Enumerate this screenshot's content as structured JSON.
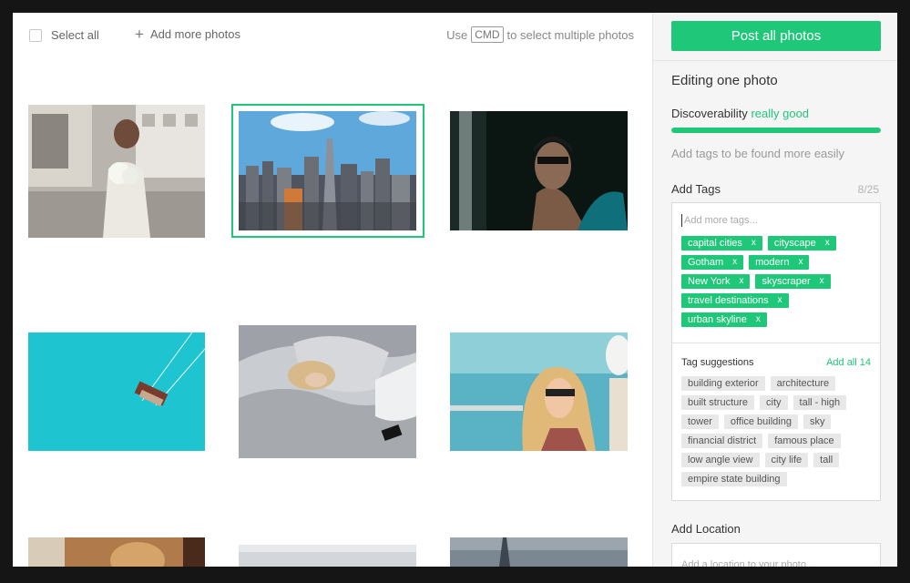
{
  "toolbar": {
    "select_all_label": "Select all",
    "add_more_label": "Add more photos",
    "hint_prefix": "Use",
    "hint_key": "CMD",
    "hint_suffix": "to select multiple photos"
  },
  "photos": [
    {
      "subject": "woman with flowers on street",
      "selected": false
    },
    {
      "subject": "city skyline",
      "selected": true
    },
    {
      "subject": "man in car window",
      "selected": false
    },
    {
      "subject": "swing ride over turquoise sky",
      "selected": false
    },
    {
      "subject": "person sleeping in bed",
      "selected": false
    },
    {
      "subject": "blonde woman with sunglasses by sea",
      "selected": false
    },
    {
      "subject": "person portrait (cropped)",
      "selected": false
    },
    {
      "subject": "blurred interior (cropped)",
      "selected": false
    },
    {
      "subject": "city spire (cropped)",
      "selected": false
    }
  ],
  "panel": {
    "post_button": "Post all photos",
    "title": "Editing one photo",
    "discoverability_label": "Discoverability",
    "discoverability_value": "really good",
    "discoverability_level": 1.0,
    "tags_hint": "Add tags to be found more easily",
    "add_tags_label": "Add Tags",
    "tag_count": "8/25",
    "tag_input_placeholder": "Add more tags...",
    "tag_remove_glyph": "x",
    "tags": [
      "capital cities",
      "cityscape",
      "Gotham",
      "modern",
      "New York",
      "skyscraper",
      "travel destinations",
      "urban skyline"
    ],
    "suggestions_label": "Tag suggestions",
    "add_all_label": "Add all 14",
    "suggestions": [
      "building exterior",
      "architecture",
      "built structure",
      "city",
      "tall - high",
      "tower",
      "office building",
      "sky",
      "financial district",
      "famous place",
      "low angle view",
      "city life",
      "tall",
      "empire state building"
    ],
    "add_location_label": "Add Location",
    "location_placeholder": "Add a location to your photo..."
  },
  "colors": {
    "accent": "#1fc779",
    "panel_bg": "#f5f5f5",
    "page_bg": "#151515"
  }
}
